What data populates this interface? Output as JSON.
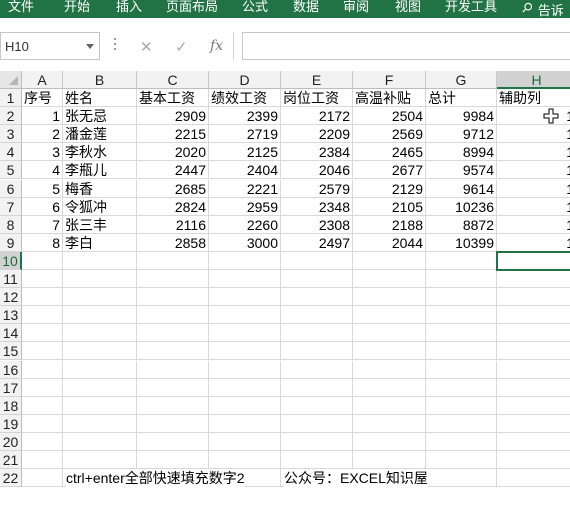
{
  "ribbon": {
    "tabs": [
      "文件",
      "开始",
      "插入",
      "页面布局",
      "公式",
      "数据",
      "审阅",
      "视图",
      "开发工具"
    ],
    "tell_me": "告诉我"
  },
  "formula_bar": {
    "name_box": "H10",
    "formula": ""
  },
  "columns": [
    "A",
    "B",
    "C",
    "D",
    "E",
    "F",
    "G",
    "H"
  ],
  "rows": [
    "1",
    "2",
    "3",
    "4",
    "5",
    "6",
    "7",
    "8",
    "9",
    "10",
    "11",
    "12",
    "13",
    "14",
    "15",
    "16",
    "17",
    "18",
    "19",
    "20",
    "21",
    "22"
  ],
  "active_cell": "H10",
  "table": {
    "headers": [
      "序号",
      "姓名",
      "基本工资",
      "绩效工资",
      "岗位工资",
      "高温补贴",
      "总计",
      "辅助列"
    ],
    "rows": [
      [
        "1",
        "张无忌",
        "2909",
        "2399",
        "2172",
        "2504",
        "9984",
        "1"
      ],
      [
        "2",
        "潘金莲",
        "2215",
        "2719",
        "2209",
        "2569",
        "9712",
        "1"
      ],
      [
        "3",
        "李秋水",
        "2020",
        "2125",
        "2384",
        "2465",
        "8994",
        "1"
      ],
      [
        "4",
        "李瓶儿",
        "2447",
        "2404",
        "2046",
        "2677",
        "9574",
        "1"
      ],
      [
        "5",
        "梅香",
        "2685",
        "2221",
        "2579",
        "2129",
        "9614",
        "1"
      ],
      [
        "6",
        "令狐冲",
        "2824",
        "2959",
        "2348",
        "2105",
        "10236",
        "1"
      ],
      [
        "7",
        "张三丰",
        "2116",
        "2260",
        "2308",
        "2188",
        "8872",
        "1"
      ],
      [
        "8",
        "李白",
        "2858",
        "3000",
        "2497",
        "2044",
        "10399",
        "1"
      ]
    ]
  },
  "notes": {
    "row22_tip": "ctrl+enter全部快速填充数字2",
    "row22_account": "公众号：EXCEL知识屋"
  },
  "colors": {
    "ribbon": "#217346",
    "selection": "#217346"
  }
}
